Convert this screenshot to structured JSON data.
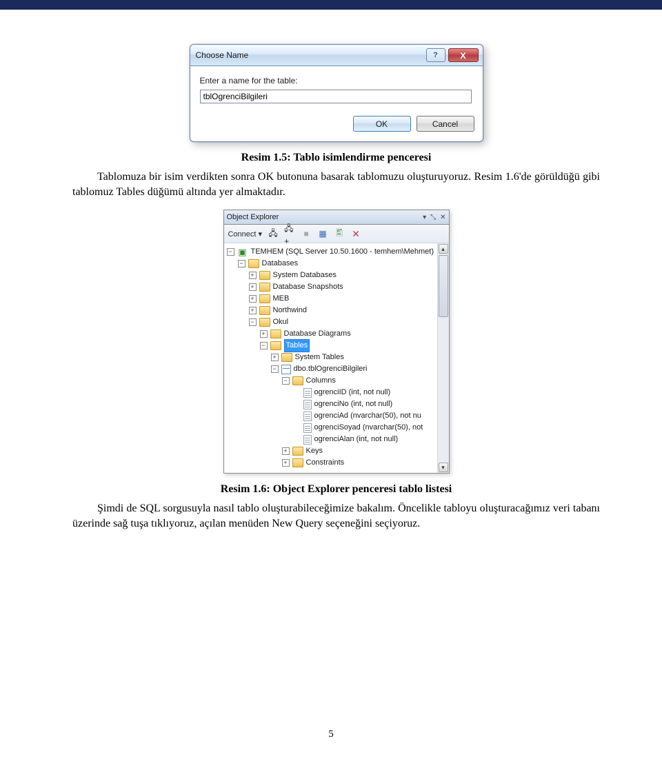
{
  "dialog": {
    "title": "Choose Name",
    "label": "Enter a name for the table:",
    "value": "tblOgrenciBilgileri",
    "ok": "OK",
    "cancel": "Cancel",
    "help": "?",
    "close": "X"
  },
  "caption1": "Resim 1.5: Tablo isimlendirme penceresi",
  "para1": "Tablomuza bir isim verdikten sonra OK butonuna basarak tablomuzu oluşturuyoruz. Resim 1.6'de görüldüğü gibi tablomuz Tables düğümü altında yer almaktadır.",
  "oe": {
    "title": "Object Explorer",
    "pin": "▾",
    "dock": "⤡",
    "close": "✕",
    "toolbar": {
      "connect": "Connect ▾",
      "icons": [
        "🖧",
        "🖧+",
        "■",
        "▦",
        "🖺",
        "🗙"
      ]
    },
    "scroll_up": "▴",
    "scroll_down": "▾",
    "tree": [
      {
        "ind": 0,
        "pm": "−",
        "icon": "server",
        "label": "TEMHEM (SQL Server 10.50.1600 - temhem\\Mehmet)"
      },
      {
        "ind": 1,
        "pm": "−",
        "icon": "folder",
        "label": "Databases"
      },
      {
        "ind": 2,
        "pm": "+",
        "icon": "folder",
        "label": "System Databases"
      },
      {
        "ind": 2,
        "pm": "+",
        "icon": "folder",
        "label": "Database Snapshots"
      },
      {
        "ind": 2,
        "pm": "+",
        "icon": "folder",
        "label": "MEB"
      },
      {
        "ind": 2,
        "pm": "+",
        "icon": "folder",
        "label": "Northwind"
      },
      {
        "ind": 2,
        "pm": "−",
        "icon": "folder",
        "label": "Okul"
      },
      {
        "ind": 3,
        "pm": "+",
        "icon": "folder",
        "label": "Database Diagrams"
      },
      {
        "ind": 3,
        "pm": "−",
        "icon": "folder",
        "label": "Tables",
        "selected": true
      },
      {
        "ind": 4,
        "pm": "+",
        "icon": "folder",
        "label": "System Tables"
      },
      {
        "ind": 4,
        "pm": "−",
        "icon": "table",
        "label": "dbo.tblOgrenciBilgileri"
      },
      {
        "ind": 5,
        "pm": "−",
        "icon": "folder",
        "label": "Columns"
      },
      {
        "ind": 6,
        "pm": " ",
        "icon": "col",
        "label": "ogrenciID (int, not null)"
      },
      {
        "ind": 6,
        "pm": " ",
        "icon": "col",
        "label": "ogrenciNo (int, not null)"
      },
      {
        "ind": 6,
        "pm": " ",
        "icon": "col",
        "label": "ogrenciAd (nvarchar(50), not nu"
      },
      {
        "ind": 6,
        "pm": " ",
        "icon": "col",
        "label": "ogrenciSoyad (nvarchar(50), not"
      },
      {
        "ind": 6,
        "pm": " ",
        "icon": "col",
        "label": "ogrenciAlan (int, not null)"
      },
      {
        "ind": 5,
        "pm": "+",
        "icon": "folder",
        "label": "Keys"
      },
      {
        "ind": 5,
        "pm": "+",
        "icon": "folder",
        "label": "Constraints"
      }
    ]
  },
  "caption2": "Resim 1.6: Object Explorer penceresi tablo listesi",
  "para2": "Şimdi de SQL sorgusuyla nasıl tablo oluşturabileceğimize bakalım. Öncelikle tabloyu oluşturacağımız veri tabanı üzerinde sağ tuşa tıklıyoruz, açılan menüden New Query seçeneğini seçiyoruz.",
  "page_number": "5"
}
